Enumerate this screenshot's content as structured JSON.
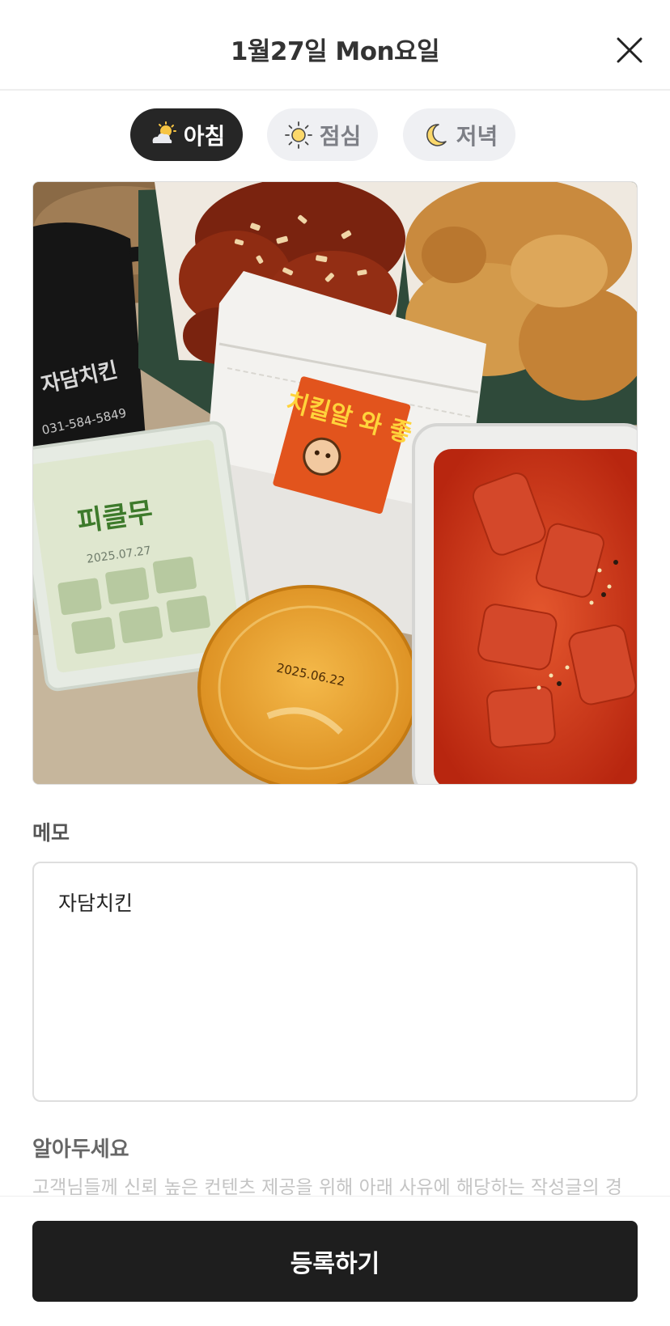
{
  "header": {
    "title": "1월27일 Mon요일",
    "close_icon": "close-icon"
  },
  "meal_tabs": [
    {
      "label": "아침",
      "icon": "sun-behind-cloud-icon",
      "active": true
    },
    {
      "label": "점심",
      "icon": "sun-icon",
      "active": false
    },
    {
      "label": "저녁",
      "icon": "moon-icon",
      "active": false
    }
  ],
  "photo": {
    "sticker_text": "치킬알 와 좋",
    "pickle_label": "피클무",
    "pickle_date": "2025.07.27",
    "sauce_date": "2025.06.22",
    "mug_text": "자담치킨",
    "mug_phone": "031-584-5849"
  },
  "memo": {
    "label": "메모",
    "value": "자담치킨"
  },
  "notice": {
    "title": "알아두세요",
    "text": "고객님들께 신뢰 높은 컨텐츠 제공을 위해 아래 사유에 해당하는 작성글의 경"
  },
  "footer": {
    "submit_label": "등록하기"
  },
  "colors": {
    "active_tab_bg": "#262626",
    "inactive_tab_bg": "#eff0f3",
    "button_bg": "#1e1e1e"
  }
}
